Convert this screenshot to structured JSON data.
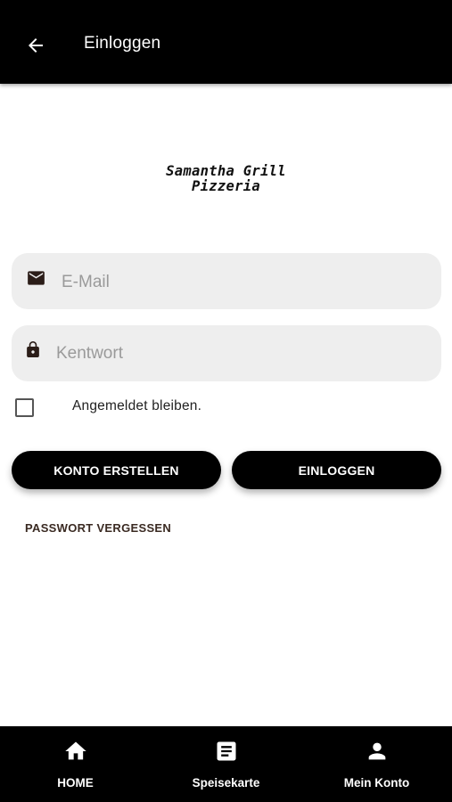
{
  "appbar": {
    "title": "Einloggen",
    "back_icon": "arrow-left-icon"
  },
  "logo": {
    "line1": "Samantha Grill",
    "line2": "Pizzeria"
  },
  "form": {
    "email": {
      "icon": "mail-icon",
      "placeholder": "E-Mail",
      "value": ""
    },
    "password": {
      "icon": "lock-icon",
      "placeholder": "Kentwort",
      "value": ""
    },
    "remember": {
      "label": "Angemeldet bleiben.",
      "checked": false
    },
    "register_label": "KONTO ERSTELLEN",
    "login_label": "EINLOGGEN",
    "forgot_label": "PASSWORT VERGESSEN"
  },
  "nav": {
    "items": [
      {
        "label": "HOME",
        "icon": "home-icon"
      },
      {
        "label": "Speisekarte",
        "icon": "menu-document-icon"
      },
      {
        "label": "Mein Konto",
        "icon": "person-icon"
      }
    ]
  },
  "colors": {
    "bar": "#000000",
    "field_bg": "#eeeeee",
    "button_bg": "#000000",
    "link": "#3a2a22"
  }
}
